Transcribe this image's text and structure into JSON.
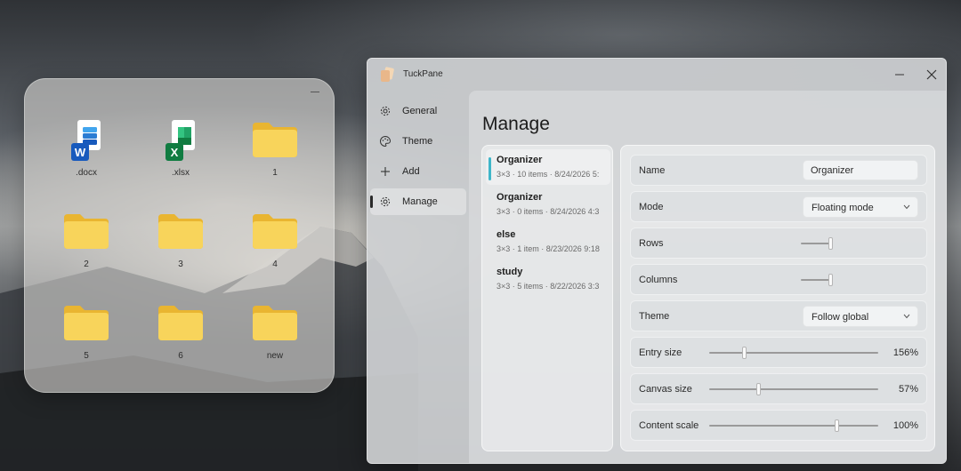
{
  "colors": {
    "accent": "#3fb6c9",
    "folder": "#f5c842",
    "word_blue": "#185abd",
    "excel_green": "#107c41"
  },
  "organizer_pane": {
    "items": [
      {
        "label": ".docx",
        "icon": "word-document-icon"
      },
      {
        "label": ".xlsx",
        "icon": "excel-workbook-icon"
      },
      {
        "label": "1",
        "icon": "folder-icon"
      },
      {
        "label": "2",
        "icon": "folder-icon"
      },
      {
        "label": "3",
        "icon": "folder-icon"
      },
      {
        "label": "4",
        "icon": "folder-icon"
      },
      {
        "label": "5",
        "icon": "folder-icon"
      },
      {
        "label": "6",
        "icon": "folder-icon"
      },
      {
        "label": "new",
        "icon": "folder-icon"
      }
    ]
  },
  "window": {
    "title": "TuckPane",
    "nav": [
      {
        "label": "General",
        "icon": "gear-icon"
      },
      {
        "label": "Theme",
        "icon": "palette-icon"
      },
      {
        "label": "Add",
        "icon": "plus-icon"
      },
      {
        "label": "Manage",
        "icon": "gear-icon",
        "active": true
      }
    ],
    "page_title": "Manage",
    "organizers": [
      {
        "name": "Organizer",
        "meta": "3×3 · 10 items · 8/24/2026 5:",
        "selected": true
      },
      {
        "name": "Organizer",
        "meta": "3×3 · 0 items · 8/24/2026 4:3"
      },
      {
        "name": "else",
        "meta": "3×3 · 1 item · 8/23/2026 9:18"
      },
      {
        "name": "study",
        "meta": "3×3 · 5 items · 8/22/2026 3:3"
      }
    ],
    "settings": {
      "name": {
        "label": "Name",
        "value": "Organizer"
      },
      "mode": {
        "label": "Mode",
        "value": "Floating mode"
      },
      "rows": {
        "label": "Rows",
        "level": 3,
        "max": 3
      },
      "columns": {
        "label": "Columns",
        "level": 3,
        "max": 3
      },
      "theme": {
        "label": "Theme",
        "value": "Follow global"
      },
      "entry_size": {
        "label": "Entry size",
        "value": "156%",
        "fraction": 0.2
      },
      "canvas_size": {
        "label": "Canvas size",
        "value": "57%",
        "fraction": 0.29
      },
      "content_scale": {
        "label": "Content scale",
        "value": "100%",
        "fraction": 0.76
      }
    }
  }
}
